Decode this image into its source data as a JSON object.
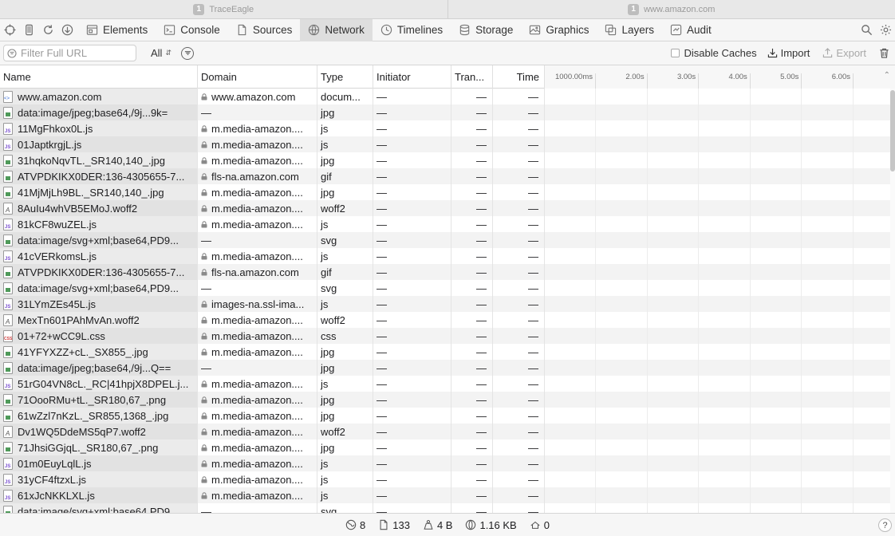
{
  "window_tabs": [
    {
      "index": "1",
      "title": "TraceEagle"
    },
    {
      "index": "1",
      "title": "www.amazon.com"
    }
  ],
  "toolbar": {
    "tabs": [
      {
        "label": "Elements",
        "icon": "elements-icon"
      },
      {
        "label": "Console",
        "icon": "console-icon"
      },
      {
        "label": "Sources",
        "icon": "sources-icon"
      },
      {
        "label": "Network",
        "icon": "network-icon",
        "active": true
      },
      {
        "label": "Timelines",
        "icon": "timelines-icon"
      },
      {
        "label": "Storage",
        "icon": "storage-icon"
      },
      {
        "label": "Graphics",
        "icon": "graphics-icon"
      },
      {
        "label": "Layers",
        "icon": "layers-icon"
      },
      {
        "label": "Audit",
        "icon": "audit-icon"
      }
    ]
  },
  "filter": {
    "placeholder": "Filter Full URL",
    "value": "",
    "scope": "All",
    "disable_caches_label": "Disable Caches",
    "disable_caches_checked": false,
    "import_label": "Import",
    "export_label": "Export"
  },
  "columns": {
    "name": "Name",
    "domain": "Domain",
    "type": "Type",
    "initiator": "Initiator",
    "transferred": "Tran...",
    "time": "Time"
  },
  "waterfall_ticks": [
    "1000.00ms",
    "2.00s",
    "3.00s",
    "4.00s",
    "5.00s",
    "6.00s"
  ],
  "rows": [
    {
      "name": "www.amazon.com",
      "icon": "doc",
      "domain": "www.amazon.com",
      "secure": true,
      "type": "docum...",
      "initiator": "—",
      "transferred": "—",
      "time": "—"
    },
    {
      "name": "data:image/jpeg;base64,/9j...9k=",
      "icon": "img",
      "domain": "—",
      "secure": false,
      "type": "jpg",
      "initiator": "—",
      "transferred": "—",
      "time": "—"
    },
    {
      "name": "11MgFhkox0L.js",
      "icon": "js",
      "domain": "m.media-amazon....",
      "secure": true,
      "type": "js",
      "initiator": "—",
      "transferred": "—",
      "time": "—"
    },
    {
      "name": "01JaptkrgjL.js",
      "icon": "js",
      "domain": "m.media-amazon....",
      "secure": true,
      "type": "js",
      "initiator": "—",
      "transferred": "—",
      "time": "—"
    },
    {
      "name": "31hqkoNqvTL._SR140,140_.jpg",
      "icon": "img",
      "domain": "m.media-amazon....",
      "secure": true,
      "type": "jpg",
      "initiator": "—",
      "transferred": "—",
      "time": "—"
    },
    {
      "name": "ATVPDKIKX0DER:136-4305655-7...",
      "icon": "img",
      "domain": "fls-na.amazon.com",
      "secure": true,
      "type": "gif",
      "initiator": "—",
      "transferred": "—",
      "time": "—"
    },
    {
      "name": "41MjMjLh9BL._SR140,140_.jpg",
      "icon": "img",
      "domain": "m.media-amazon....",
      "secure": true,
      "type": "jpg",
      "initiator": "—",
      "transferred": "—",
      "time": "—"
    },
    {
      "name": "8AuIu4whVB5EMoJ.woff2",
      "icon": "font",
      "domain": "m.media-amazon....",
      "secure": true,
      "type": "woff2",
      "initiator": "—",
      "transferred": "—",
      "time": "—"
    },
    {
      "name": "81kCF8wuZEL.js",
      "icon": "js",
      "domain": "m.media-amazon....",
      "secure": true,
      "type": "js",
      "initiator": "—",
      "transferred": "—",
      "time": "—"
    },
    {
      "name": "data:image/svg+xml;base64,PD9...",
      "icon": "img",
      "domain": "—",
      "secure": false,
      "type": "svg",
      "initiator": "—",
      "transferred": "—",
      "time": "—"
    },
    {
      "name": "41cVERkomsL.js",
      "icon": "js",
      "domain": "m.media-amazon....",
      "secure": true,
      "type": "js",
      "initiator": "—",
      "transferred": "—",
      "time": "—"
    },
    {
      "name": "ATVPDKIKX0DER:136-4305655-7...",
      "icon": "img",
      "domain": "fls-na.amazon.com",
      "secure": true,
      "type": "gif",
      "initiator": "—",
      "transferred": "—",
      "time": "—"
    },
    {
      "name": "data:image/svg+xml;base64,PD9...",
      "icon": "img",
      "domain": "—",
      "secure": false,
      "type": "svg",
      "initiator": "—",
      "transferred": "—",
      "time": "—"
    },
    {
      "name": "31LYmZEs45L.js",
      "icon": "js",
      "domain": "images-na.ssl-ima...",
      "secure": true,
      "type": "js",
      "initiator": "—",
      "transferred": "—",
      "time": "—"
    },
    {
      "name": "MexTn601PAhMvAn.woff2",
      "icon": "font",
      "domain": "m.media-amazon....",
      "secure": true,
      "type": "woff2",
      "initiator": "—",
      "transferred": "—",
      "time": "—"
    },
    {
      "name": "01+72+wCC9L.css",
      "icon": "css",
      "domain": "m.media-amazon....",
      "secure": true,
      "type": "css",
      "initiator": "—",
      "transferred": "—",
      "time": "—"
    },
    {
      "name": "41YFYXZZ+cL._SX855_.jpg",
      "icon": "img",
      "domain": "m.media-amazon....",
      "secure": true,
      "type": "jpg",
      "initiator": "—",
      "transferred": "—",
      "time": "—"
    },
    {
      "name": "data:image/jpeg;base64,/9j...Q==",
      "icon": "img",
      "domain": "—",
      "secure": false,
      "type": "jpg",
      "initiator": "—",
      "transferred": "—",
      "time": "—"
    },
    {
      "name": "51rG04VN8cL._RC|41hpjX8DPEL.j...",
      "icon": "js",
      "domain": "m.media-amazon....",
      "secure": true,
      "type": "js",
      "initiator": "—",
      "transferred": "—",
      "time": "—"
    },
    {
      "name": "71OooRMu+tL._SR180,67_.png",
      "icon": "img",
      "domain": "m.media-amazon....",
      "secure": true,
      "type": "jpg",
      "initiator": "—",
      "transferred": "—",
      "time": "—"
    },
    {
      "name": "61wZzl7nKzL._SR855,1368_.jpg",
      "icon": "img",
      "domain": "m.media-amazon....",
      "secure": true,
      "type": "jpg",
      "initiator": "—",
      "transferred": "—",
      "time": "—"
    },
    {
      "name": "Dv1WQ5DdeMS5qP7.woff2",
      "icon": "font",
      "domain": "m.media-amazon....",
      "secure": true,
      "type": "woff2",
      "initiator": "—",
      "transferred": "—",
      "time": "—"
    },
    {
      "name": "71JhsiGGjqL._SR180,67_.png",
      "icon": "img",
      "domain": "m.media-amazon....",
      "secure": true,
      "type": "jpg",
      "initiator": "—",
      "transferred": "—",
      "time": "—"
    },
    {
      "name": "01m0EuyLqlL.js",
      "icon": "js",
      "domain": "m.media-amazon....",
      "secure": true,
      "type": "js",
      "initiator": "—",
      "transferred": "—",
      "time": "—"
    },
    {
      "name": "31yCF4ftzxL.js",
      "icon": "js",
      "domain": "m.media-amazon....",
      "secure": true,
      "type": "js",
      "initiator": "—",
      "transferred": "—",
      "time": "—"
    },
    {
      "name": "61xJcNKKLXL.js",
      "icon": "js",
      "domain": "m.media-amazon....",
      "secure": true,
      "type": "js",
      "initiator": "—",
      "transferred": "—",
      "time": "—"
    },
    {
      "name": "data:image/svg+xml;base64,PD9...",
      "icon": "img",
      "domain": "—",
      "secure": false,
      "type": "svg",
      "initiator": "—",
      "transferred": "—",
      "time": "—"
    }
  ],
  "status": {
    "domains": "8",
    "resources": "133",
    "transferred": "4 B",
    "size": "1.16 KB",
    "redirects": "0",
    "help": "?"
  }
}
